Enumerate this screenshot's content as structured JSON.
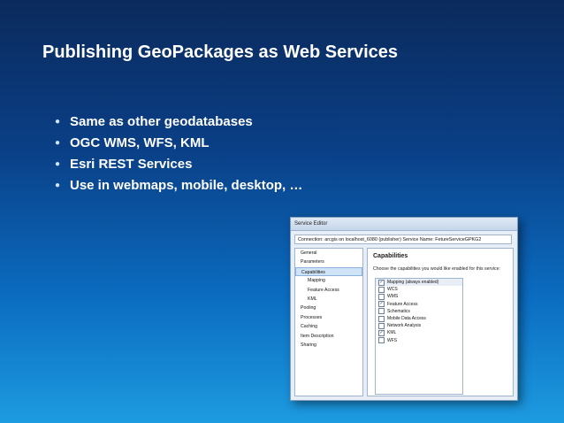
{
  "slide": {
    "title": "Publishing GeoPackages as Web Services",
    "bullets": [
      "Same as other geodatabases",
      "OGC WMS, WFS, KML",
      "Esri REST Services",
      "Use in webmaps, mobile, desktop, …"
    ]
  },
  "service_editor": {
    "window_title": "Service Editor",
    "connection_text": "Connection: arcgis on localhost_6080 (publisher)   Service Name: FetureServiceGPKG2",
    "nav_items": [
      {
        "label": "General",
        "sub": false,
        "selected": false
      },
      {
        "label": "Parameters",
        "sub": false,
        "selected": false
      },
      {
        "label": "Capabilities",
        "sub": false,
        "selected": true
      },
      {
        "label": "Mapping",
        "sub": true,
        "selected": false
      },
      {
        "label": "Feature Access",
        "sub": true,
        "selected": false
      },
      {
        "label": "KML",
        "sub": true,
        "selected": false
      },
      {
        "label": "Pooling",
        "sub": false,
        "selected": false
      },
      {
        "label": "Processes",
        "sub": false,
        "selected": false
      },
      {
        "label": "Caching",
        "sub": false,
        "selected": false
      },
      {
        "label": "Item Description",
        "sub": false,
        "selected": false
      },
      {
        "label": "Sharing",
        "sub": false,
        "selected": false
      }
    ],
    "panel_heading": "Capabilities",
    "panel_description": "Choose the capabilities you would like enabled for this service:",
    "capabilities": [
      {
        "label": "Mapping (always enabled)",
        "checked": true
      },
      {
        "label": "WCS",
        "checked": false
      },
      {
        "label": "WMS",
        "checked": false
      },
      {
        "label": "Feature Access",
        "checked": true
      },
      {
        "label": "Schematics",
        "checked": false
      },
      {
        "label": "Mobile Data Access",
        "checked": false
      },
      {
        "label": "Network Analysis",
        "checked": false
      },
      {
        "label": "KML",
        "checked": true
      },
      {
        "label": "WFS",
        "checked": false
      }
    ]
  }
}
